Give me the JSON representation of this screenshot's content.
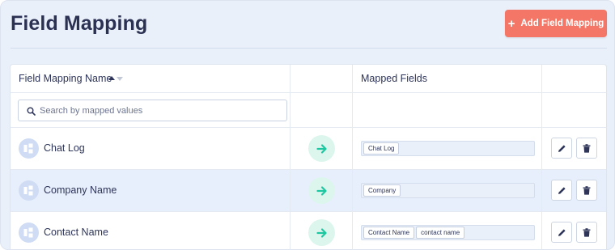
{
  "header": {
    "title": "Field Mapping",
    "add_button_icon": "plus-icon",
    "add_button_label": "Add Field Mapping"
  },
  "table": {
    "columns": [
      {
        "label": "Field Mapping Name",
        "sort": "ascending"
      },
      {
        "label": ""
      },
      {
        "label": "Mapped Fields"
      },
      {
        "label": ""
      }
    ],
    "search": {
      "placeholder": "Search by mapped values",
      "value": ""
    },
    "rows": [
      {
        "name": "Chat Log",
        "mapped_fields": [
          "Chat Log"
        ],
        "selected": false
      },
      {
        "name": "Company Name",
        "mapped_fields": [
          "Company"
        ],
        "selected": true
      },
      {
        "name": "Contact Name",
        "mapped_fields": [
          "Contact Name",
          "contact name"
        ],
        "selected": false
      }
    ]
  },
  "colors": {
    "accent_button": "#f47666",
    "arrow": "#1ec7a0",
    "arrow_bg": "#dcf6ee",
    "selected_row": "#e7effc",
    "page_bg": "#eaf0fa",
    "text": "#2e3558"
  },
  "icons": {
    "row": "field-mapping-icon",
    "arrow": "arrow-right-icon",
    "edit": "pencil-icon",
    "delete": "trash-icon",
    "search": "search-icon",
    "sort": "sort-icon"
  }
}
